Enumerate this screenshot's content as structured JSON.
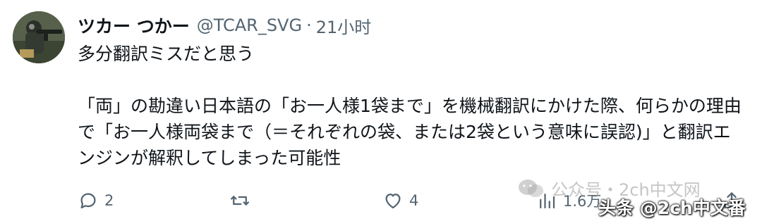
{
  "author": {
    "display_name": "ツカー つかー",
    "handle": "@TCAR_SVG",
    "separator": "·",
    "time": "21小时",
    "avatar_icon": "soldier-photo-avatar"
  },
  "body": {
    "line1": "多分翻訳ミスだと思う",
    "paragraph2": "「両」の勘違い日本語の「お一人様1袋まで」を機械翻訳にかけた際、何らかの理由で「お一人様両袋まで（＝それぞれの袋、または2袋という意味に誤認)」と翻訳エンジンが解釈してしまった可能性"
  },
  "actions": {
    "reply": {
      "icon": "reply-icon",
      "count": "2"
    },
    "retweet": {
      "icon": "retweet-icon",
      "count": ""
    },
    "like": {
      "icon": "heart-icon",
      "count": "4"
    },
    "views": {
      "icon": "views-icon",
      "count": "1.6万"
    },
    "share": {
      "icon": "share-icon"
    }
  },
  "watermarks": {
    "top": "公众号・2ch中文网",
    "bottom": "头条 @2ch中文番"
  },
  "colors": {
    "text": "#0f1419",
    "secondary": "#536471"
  }
}
